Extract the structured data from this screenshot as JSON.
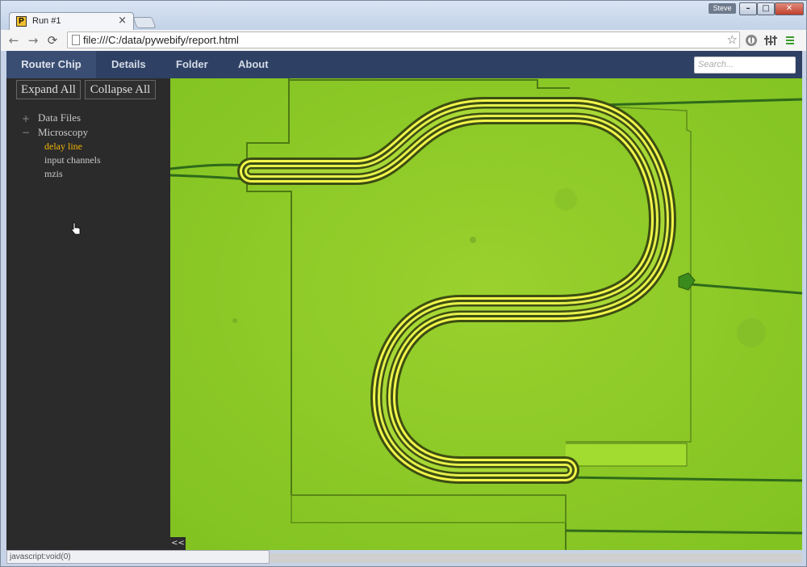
{
  "browser": {
    "tab_title": "Run #1",
    "tab_favicon": "P",
    "tab_close_icon": "×",
    "profile_name": "Steve",
    "url": "file:///C:/data/pywebify/report.html",
    "window_buttons": {
      "minimize": "–",
      "maximize": "□",
      "close": "✕"
    },
    "nav": {
      "back": "←",
      "forward": "→",
      "reload": "⟳"
    },
    "star_icon": "☆",
    "status_text": "javascript:void(0)"
  },
  "app": {
    "brand": "Router Chip",
    "nav_links": [
      "Details",
      "Folder",
      "About"
    ],
    "search_placeholder": "Search..."
  },
  "sidebar": {
    "expand_all": "Expand All",
    "collapse_all": "Collapse All",
    "tree": [
      {
        "toggle": "+",
        "label": "Data Files",
        "expanded": false
      },
      {
        "toggle": "−",
        "label": "Microscopy",
        "expanded": true,
        "children": [
          {
            "label": "delay line",
            "active": true
          },
          {
            "label": "input channels",
            "active": false
          },
          {
            "label": "mzis",
            "active": false
          }
        ]
      }
    ],
    "collapse_button": "<<"
  },
  "colors": {
    "navbar": "#2e4165",
    "brand_bg": "#3a4e74",
    "sidebar": "#2b2b2b",
    "active_item": "#f4b400",
    "image_green": "#8fcf2a"
  }
}
